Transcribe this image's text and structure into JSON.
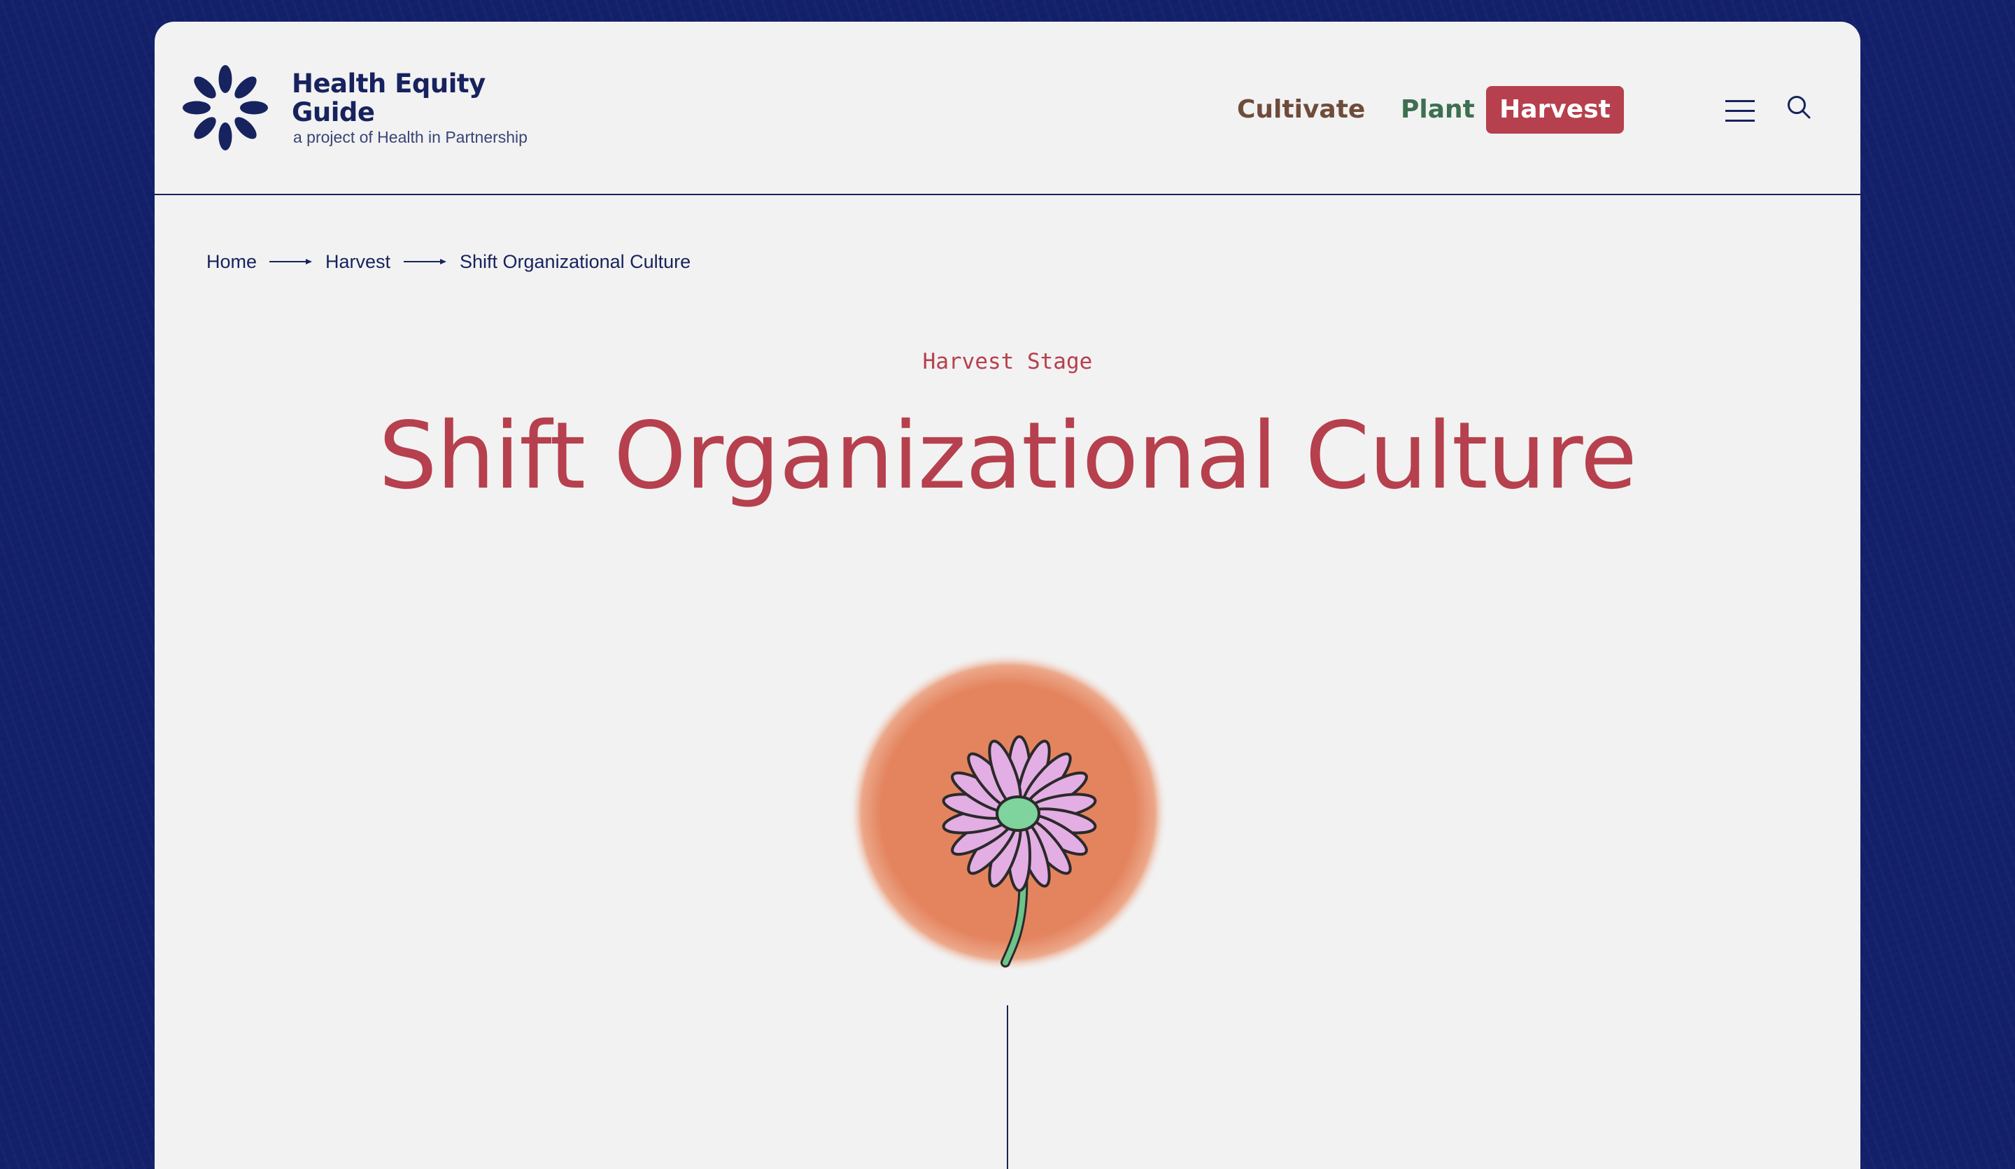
{
  "logo": {
    "title": "Health Equity Guide",
    "subtitle": "a project of Health in Partnership",
    "icon": "flower-petals-logo-icon"
  },
  "nav": {
    "cultivate": "Cultivate",
    "plant": "Plant",
    "harvest": "Harvest",
    "menu_icon": "hamburger-menu-icon",
    "search_icon": "search-icon"
  },
  "breadcrumb": {
    "items": [
      "Home",
      "Harvest",
      "Shift Organizational Culture"
    ],
    "separator_icon": "arrow-right-icon"
  },
  "page": {
    "eyebrow": "Harvest Stage",
    "title": "Shift Organizational Culture",
    "hero_icon": "daisy-flower-illustration"
  },
  "colors": {
    "navy": "#17235e",
    "background_blue": "#13206b",
    "harvest_red": "#b6404d",
    "cultivate_brown": "#6f4c3a",
    "plant_green": "#3d7050",
    "card_bg": "#f2f2f2",
    "hero_orange": "#e4845f",
    "petal_pink": "#e3aee3",
    "flower_center_green": "#7fd39c"
  }
}
